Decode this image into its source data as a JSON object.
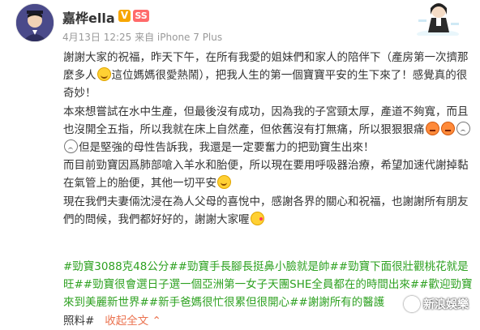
{
  "user": {
    "name": "嘉桦ella",
    "verified_label": "V",
    "member_label": "SS"
  },
  "meta_line": "4月13日 12:25 来自 iPhone 7 Plus",
  "post": {
    "line1a": "謝謝大家的祝福，昨天下午，在所有我愛的姐妹們和家人的陪伴下（產房第一次擠那麼多人",
    "line1b": "這位媽媽很愛熱鬧），把我人生的第一個寶寶平安的生下來了！感覺真的很奇妙！",
    "para2a": "本來想嘗試在水中生產，但最後沒有成功，因為我的子宮頸太厚，產道不夠寬，而且也沒開全五指，所以我就在床上自然產，但依舊沒有打無痛，所以狠狠狠痛",
    "para2b": "但是堅強的母性告訴我，我還是一定要奮力的把勁寶生出來！",
    "para3a": "而目前勁寶因爲肺部嗆入羊水和胎便，所以現在要用呼吸器治療，希望加速代謝掉黏在氣管上的胎便，其他一切平安",
    "para4a": "現在我們夫妻倆沈浸在為人父母的喜悅中，感謝各界的關心和祝福，也謝謝所有朋友們的問候，我們都好好的，謝謝大家喔"
  },
  "hashtags": {
    "text": "#勁寶3088克48公分##勁寶手長腳長挺鼻小臉就是帥##勁寶下面很壯觀桃花就是旺##勁寶很會選日子選一個亞洲第一女子天團SHE全員都在的時間出來##歡迎勁寶來到美麗新世界##新手爸媽很忙很累但很開心##謝謝所有的醫護",
    "tail": "照料#",
    "collapse_label": "收起全文"
  },
  "watermark": {
    "text": "新浪娛樂"
  },
  "colors": {
    "tag_green": "#2ea121",
    "meta_gray": "#999999",
    "link_orange": "#eb7350"
  }
}
